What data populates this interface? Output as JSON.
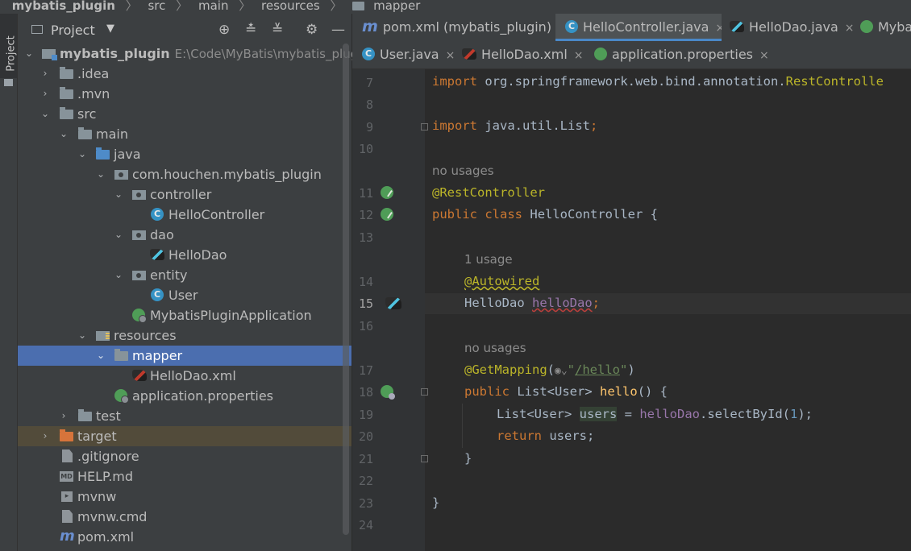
{
  "breadcrumb": {
    "items": [
      "mybatis_plugin",
      "src",
      "main",
      "resources",
      "mapper"
    ],
    "separator": "〉"
  },
  "tool_window": {
    "side_label": "Project",
    "title": "Project",
    "dropdown_arrow": "▼",
    "buttons": [
      "⊕",
      "≛",
      "≚",
      "⚙",
      "—"
    ]
  },
  "tree": {
    "rows": [
      {
        "label": "mybatis_plugin",
        "path": "E:\\Code\\MyBatis\\mybatis_plugin\\"
      },
      {
        "label": ".idea"
      },
      {
        "label": ".mvn"
      },
      {
        "label": "src"
      },
      {
        "label": "main"
      },
      {
        "label": "java"
      },
      {
        "label": "com.houchen.mybatis_plugin"
      },
      {
        "label": "controller"
      },
      {
        "label": "HelloController"
      },
      {
        "label": "dao"
      },
      {
        "label": "HelloDao"
      },
      {
        "label": "entity"
      },
      {
        "label": "User"
      },
      {
        "label": "MybatisPluginApplication"
      },
      {
        "label": "resources"
      },
      {
        "label": "mapper"
      },
      {
        "label": "HelloDao.xml"
      },
      {
        "label": "application.properties"
      },
      {
        "label": "test"
      },
      {
        "label": "target"
      },
      {
        "label": ".gitignore"
      },
      {
        "label": "HELP.md"
      },
      {
        "label": "mvnw"
      },
      {
        "label": "mvnw.cmd"
      },
      {
        "label": "pom.xml"
      }
    ]
  },
  "editor_tabs": {
    "row1": [
      {
        "label": "pom.xml (mybatis_plugin)",
        "icon": "maven-icon"
      },
      {
        "label": "HelloController.java",
        "icon": "class-icon",
        "active": true
      },
      {
        "label": "HelloDao.java",
        "icon": "mybatis-icon"
      },
      {
        "label": "Myba",
        "icon": "spring-app-icon"
      }
    ],
    "row2": [
      {
        "label": "User.java",
        "icon": "class-icon"
      },
      {
        "label": "HelloDao.xml",
        "icon": "mybatis-xml-icon"
      },
      {
        "label": "application.properties",
        "icon": "spring-properties-icon"
      }
    ],
    "close_glyph": "×"
  },
  "code": {
    "line_numbers": [
      "7",
      "8",
      "9",
      "10",
      "11",
      "12",
      "13",
      "14",
      "15",
      "16",
      "17",
      "18",
      "19",
      "20",
      "21",
      "22",
      "23",
      "24"
    ],
    "current_line": "15",
    "hints": {
      "no_usages": "no usages",
      "one_usage": "1 usage"
    },
    "tokens": {
      "import": "import",
      "pkg_line7": "org.springframework.web.bind.annotation.",
      "rest_controller_import": "RestControlle",
      "pkg_line9": "java.util.List",
      "semicolon": ";",
      "rest_controller": "@RestController",
      "public": "public",
      "class": "class",
      "class_name": "HelloController {",
      "autowired": "@Autowired",
      "dao_type": "HelloDao",
      "dao_field": "helloDao",
      "get_mapping": "@GetMapping",
      "open_paren": "(",
      "quote": "\"",
      "path": "/hello",
      "close_paren": ")",
      "list_user": "List<User>",
      "method": "hello",
      "method_tail": "() {",
      "users": "users",
      "assign": " = ",
      "call": ".selectById(",
      "one": "1",
      "call_end": ");",
      "return": "return",
      "users_ret": "users;",
      "close_brace": "}"
    }
  }
}
